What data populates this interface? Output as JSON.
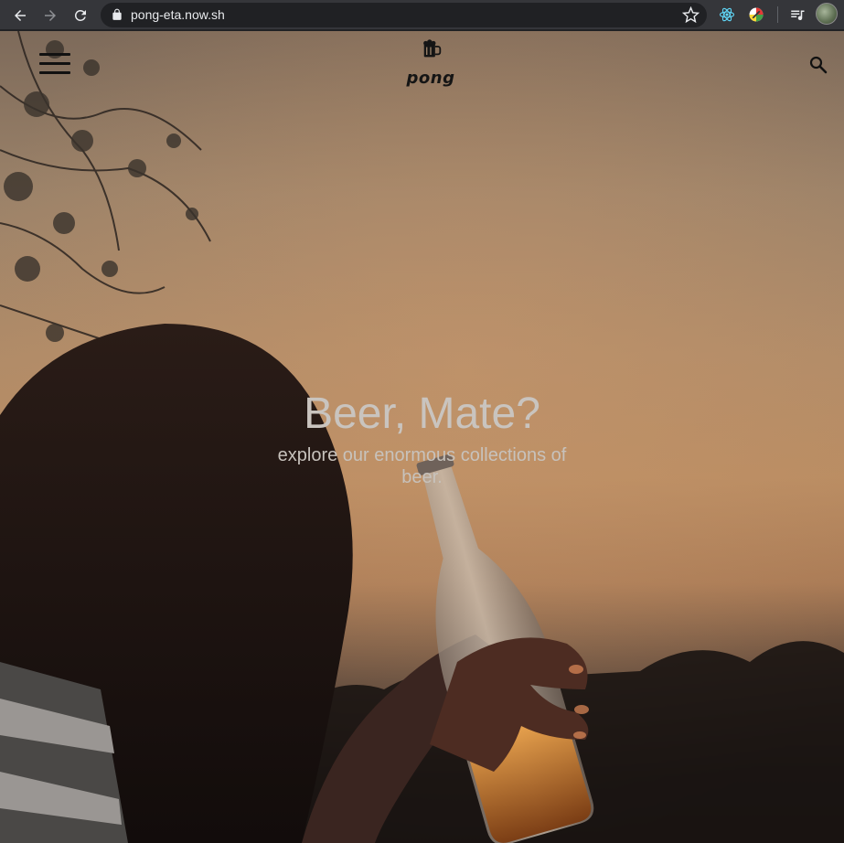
{
  "browser": {
    "url": "pong-eta.now.sh",
    "back_icon": "arrow-left-icon",
    "forward_icon": "arrow-right-icon",
    "reload_icon": "reload-icon",
    "lock_icon": "lock-icon",
    "bookmark_icon": "star-icon",
    "extensions": [
      "react-devtools-icon",
      "colorful-circle-extension-icon",
      "media-playlist-icon"
    ],
    "profile_avatar": "avatar"
  },
  "site": {
    "logo_text": "pong",
    "logo_icon": "beer-mug-icon",
    "menu_icon": "hamburger-menu-icon",
    "search_icon": "search-icon"
  },
  "hero": {
    "title": "Beer, Mate?",
    "subtitle": "explore our enormous collections of beer."
  },
  "colors": {
    "chrome_bg": "#35363a",
    "omnibox_bg": "#202124",
    "hero_text": "#c9c4bf",
    "icon_dark": "#111111"
  }
}
